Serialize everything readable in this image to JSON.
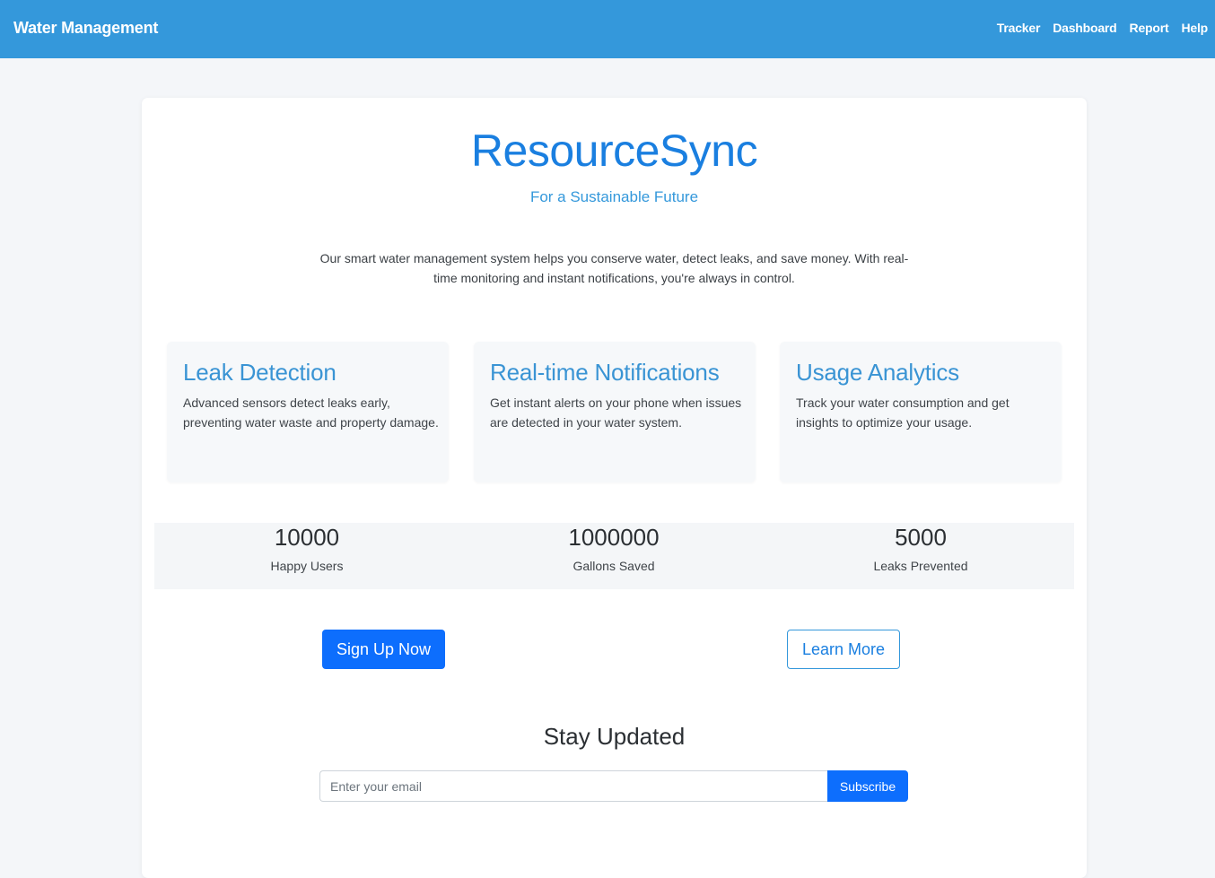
{
  "navbar": {
    "brand": "Water Management",
    "links": [
      "Tracker",
      "Dashboard",
      "Report",
      "Help"
    ],
    "background_color": "#3498db"
  },
  "hero": {
    "title": "ResourceSync",
    "subtitle": "For a Sustainable Future",
    "description": "Our smart water management system helps you conserve water, detect leaks, and save money. With real-time monitoring and instant notifications, you're always in control."
  },
  "features": [
    {
      "title": "Leak Detection",
      "description": "Advanced sensors detect leaks early, preventing water waste and property damage."
    },
    {
      "title": "Real-time Notifications",
      "description": "Get instant alerts on your phone when issues are detected in your water system."
    },
    {
      "title": "Usage Analytics",
      "description": "Track your water consumption and get insights to optimize your usage."
    }
  ],
  "stats": [
    {
      "value": "10000",
      "label": "Happy Users"
    },
    {
      "value": "1000000",
      "label": "Gallons Saved"
    },
    {
      "value": "5000",
      "label": "Leaks Prevented"
    }
  ],
  "actions": {
    "signup_label": "Sign Up Now",
    "learn_more_label": "Learn More",
    "accent_color": "#0d6efd"
  },
  "newsletter": {
    "title": "Stay Updated",
    "email_placeholder": "Enter your email",
    "email_value": "",
    "subscribe_label": "Subscribe"
  }
}
